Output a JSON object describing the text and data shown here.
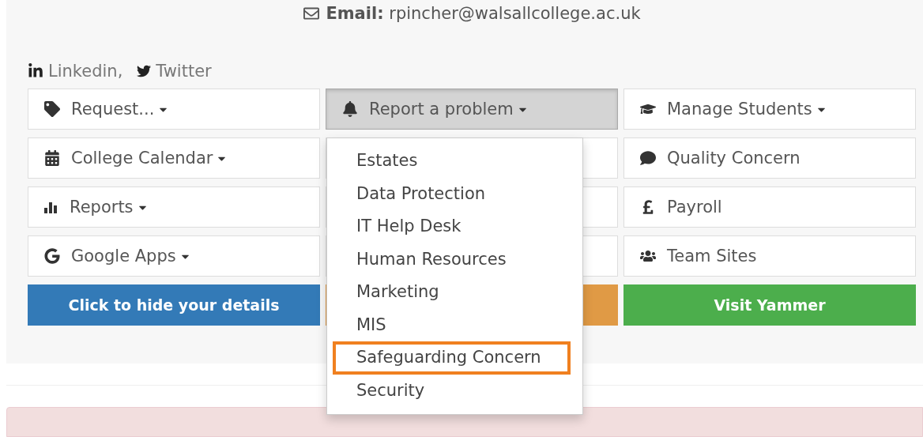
{
  "contact": {
    "email_label": "Email:",
    "email": "rpincher@walsallcollege.ac.uk"
  },
  "social": [
    {
      "kind": "linkedin",
      "label": "Linkedin,"
    },
    {
      "kind": "twitter",
      "label": "Twitter"
    }
  ],
  "menu_buttons": [
    {
      "label": "Request...",
      "dropdown": true,
      "selected": false
    },
    {
      "label": "Report a problem",
      "dropdown": true,
      "selected": true
    },
    {
      "label": "Manage Students",
      "dropdown": true,
      "selected": false
    },
    {
      "label": "College Calendar",
      "dropdown": true,
      "selected": false
    },
    {
      "label": "Quality Concern",
      "dropdown": false,
      "selected": false
    },
    {
      "label": "Reports",
      "dropdown": true,
      "selected": false
    },
    {
      "label": "Payroll",
      "dropdown": false,
      "selected": false
    },
    {
      "label": "Google Apps",
      "dropdown": true,
      "selected": false
    },
    {
      "label": "Team Sites",
      "dropdown": false,
      "selected": false
    }
  ],
  "action_buttons": [
    {
      "label": "Click to hide your details",
      "kind": "primary"
    },
    {
      "kind": "warning"
    },
    {
      "label": "Visit Yammer",
      "kind": "success"
    }
  ],
  "dropdown_menu": {
    "items": [
      {
        "label": "Estates",
        "selected": false
      },
      {
        "label": "Data Protection",
        "selected": false
      },
      {
        "label": "IT Help Desk",
        "selected": false
      },
      {
        "label": "Human Resources",
        "selected": false
      },
      {
        "label": "Marketing",
        "selected": false
      },
      {
        "label": "MIS",
        "selected": false
      },
      {
        "label": "Safeguarding Concern",
        "selected": true
      },
      {
        "label": "Security",
        "selected": false
      }
    ]
  },
  "alert": {
    "kind": "danger"
  }
}
